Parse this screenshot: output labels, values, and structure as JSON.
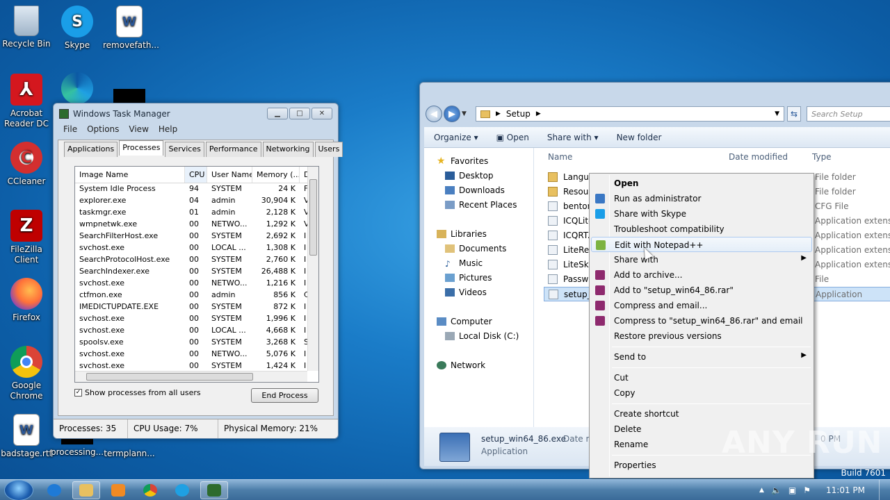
{
  "desktop_icons": [
    {
      "label": "Recycle Bin",
      "icon": "recycle-bin-icon"
    },
    {
      "label": "Skype",
      "icon": "skype-icon"
    },
    {
      "label": "removefath...",
      "icon": "word-doc-icon"
    },
    {
      "label": "Acrobat Reader DC",
      "icon": "acrobat-icon"
    },
    {
      "label": "CCleaner",
      "icon": "ccleaner-icon"
    },
    {
      "label": "FileZilla Client",
      "icon": "filezilla-icon"
    },
    {
      "label": "Firefox",
      "icon": "firefox-icon"
    },
    {
      "label": "Google Chrome",
      "icon": "chrome-icon"
    },
    {
      "label": "badstage.rtf",
      "icon": "word-doc-icon"
    },
    {
      "label": "processing...",
      "icon": "file-icon"
    },
    {
      "label": "termplann...",
      "icon": "file-icon"
    }
  ],
  "task_manager": {
    "title": "Windows Task Manager",
    "menu": [
      "File",
      "Options",
      "View",
      "Help"
    ],
    "tabs": [
      "Applications",
      "Processes",
      "Services",
      "Performance",
      "Networking",
      "Users"
    ],
    "active_tab": "Processes",
    "columns": [
      "Image Name",
      "CPU",
      "User Name",
      "Memory (...",
      "D"
    ],
    "rows": [
      [
        "System Idle Process",
        "94",
        "SYSTEM",
        "24 K",
        "F"
      ],
      [
        "explorer.exe",
        "04",
        "admin",
        "30,904 K",
        "V"
      ],
      [
        "taskmgr.exe",
        "01",
        "admin",
        "2,128 K",
        "V"
      ],
      [
        "wmpnetwk.exe",
        "00",
        "NETWO...",
        "1,292 K",
        "V"
      ],
      [
        "SearchFilterHost.exe",
        "00",
        "SYSTEM",
        "2,692 K",
        "I"
      ],
      [
        "svchost.exe",
        "00",
        "LOCAL ...",
        "1,308 K",
        "I"
      ],
      [
        "SearchProtocolHost.exe",
        "00",
        "SYSTEM",
        "2,760 K",
        "I"
      ],
      [
        "SearchIndexer.exe",
        "00",
        "SYSTEM",
        "26,488 K",
        "I"
      ],
      [
        "svchost.exe",
        "00",
        "NETWO...",
        "1,216 K",
        "I"
      ],
      [
        "ctfmon.exe",
        "00",
        "admin",
        "856 K",
        "C"
      ],
      [
        "IMEDICTUPDATE.EXE",
        "00",
        "SYSTEM",
        "872 K",
        "I"
      ],
      [
        "svchost.exe",
        "00",
        "SYSTEM",
        "1,996 K",
        "I"
      ],
      [
        "svchost.exe",
        "00",
        "LOCAL ...",
        "4,668 K",
        "I"
      ],
      [
        "spoolsv.exe",
        "00",
        "SYSTEM",
        "3,268 K",
        "S"
      ],
      [
        "svchost.exe",
        "00",
        "NETWO...",
        "5,076 K",
        "I"
      ],
      [
        "svchost.exe",
        "00",
        "SYSTEM",
        "1,424 K",
        "I"
      ]
    ],
    "show_all_label": "Show processes from all users",
    "show_all_checked": true,
    "end_process_label": "End Process",
    "status": {
      "processes": "Processes: 35",
      "cpu": "CPU Usage: 7%",
      "memory": "Physical Memory: 21%"
    }
  },
  "explorer": {
    "path": "Setup",
    "search_placeholder": "Search Setup",
    "toolbar": [
      "Organize",
      "Open",
      "Share with",
      "New folder"
    ],
    "nav": {
      "favorites": "Favorites",
      "fav_items": [
        "Desktop",
        "Downloads",
        "Recent Places"
      ],
      "libraries": "Libraries",
      "lib_items": [
        "Documents",
        "Music",
        "Pictures",
        "Videos"
      ],
      "computer": "Computer",
      "comp_items": [
        "Local Disk (C:)"
      ],
      "network": "Network"
    },
    "columns": [
      "Name",
      "Date modified",
      "Type"
    ],
    "files": [
      {
        "name": "Langua",
        "type": "File folder"
      },
      {
        "name": "Resour",
        "type": "File folder"
      },
      {
        "name": "benton",
        "type": "CFG File"
      },
      {
        "name": "ICQLite",
        "type": "Application extens..."
      },
      {
        "name": "ICQRT.",
        "type": "Application extens..."
      },
      {
        "name": "LiteRes",
        "type": "Application extens..."
      },
      {
        "name": "LiteSkin",
        "type": "Application extens..."
      },
      {
        "name": "Passwo",
        "type": "File"
      },
      {
        "name": "setup_w",
        "type": "Application"
      }
    ],
    "details": {
      "name": "setup_win64_86.exe",
      "date_label": "Date mo",
      "type": "Application",
      "time_partial": "0 PM"
    }
  },
  "context_menu": [
    {
      "label": "Open",
      "bold": true
    },
    {
      "label": "Run as administrator",
      "icon": "shield"
    },
    {
      "label": "Share with Skype",
      "icon": "skype"
    },
    {
      "label": "Troubleshoot compatibility"
    },
    {
      "label": "Edit with Notepad++",
      "icon": "notepad",
      "highlighted": true
    },
    {
      "label": "Share with",
      "submenu": true
    },
    {
      "label": "Add to archive...",
      "icon": "rar"
    },
    {
      "label": "Add to \"setup_win64_86.rar\"",
      "icon": "rar"
    },
    {
      "label": "Compress and email...",
      "icon": "rar"
    },
    {
      "label": "Compress to \"setup_win64_86.rar\" and email",
      "icon": "rar"
    },
    {
      "label": "Restore previous versions"
    },
    {
      "sep": true
    },
    {
      "label": "Send to",
      "submenu": true
    },
    {
      "sep": true
    },
    {
      "label": "Cut"
    },
    {
      "label": "Copy"
    },
    {
      "sep": true
    },
    {
      "label": "Create shortcut"
    },
    {
      "label": "Delete"
    },
    {
      "label": "Rename"
    },
    {
      "sep": true
    },
    {
      "label": "Properties"
    }
  ],
  "taskbar": {
    "clock": "11:01 PM",
    "build": "Build 7601",
    "watermark": "ANY RUN"
  },
  "colors": {
    "desktop": "#1a7cc8",
    "taskbar": "#4d7ea9",
    "highlight": "#cde3f8"
  }
}
